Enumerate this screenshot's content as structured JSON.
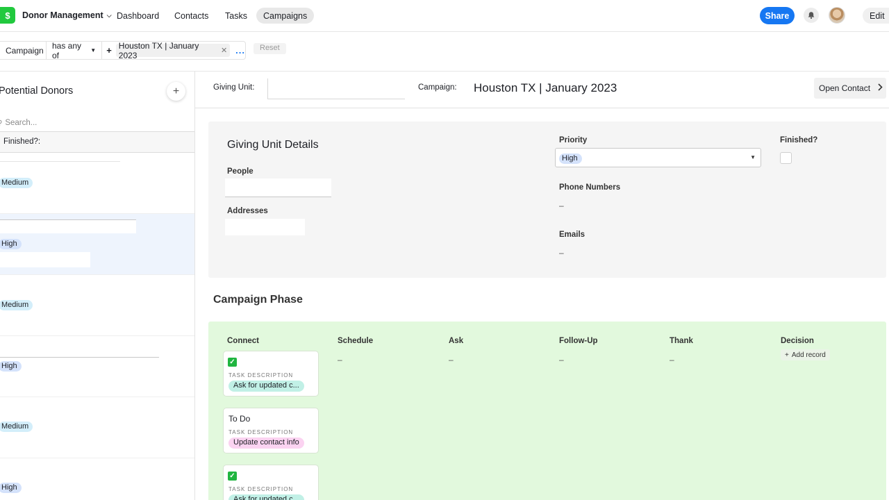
{
  "topnav": {
    "logo_glyph": "$",
    "app_title": "Donor Management",
    "tabs": [
      "Dashboard",
      "Contacts",
      "Tasks",
      "Campaigns"
    ],
    "active_tab": "Campaigns",
    "share_label": "Share",
    "edit_label": "Edit",
    "bell_icon": "bell-icon",
    "accent_color": "#1677f2",
    "logo_color": "#21c93e"
  },
  "filter": {
    "field": "Campaign",
    "operator": "has any of",
    "add_glyph": "+",
    "value": "Houston TX | January 2023",
    "more": "...",
    "reset_label": "Reset"
  },
  "sidebar": {
    "title": "Potential Donors",
    "add_glyph": "+",
    "search_placeholder": "Search...",
    "column_header": "Finished?:",
    "rows": [
      {
        "priority": "Medium"
      },
      {
        "priority": "High"
      },
      {
        "priority": "Medium"
      },
      {
        "priority": "High"
      },
      {
        "priority": "Medium"
      },
      {
        "priority": "High"
      }
    ]
  },
  "record": {
    "giving_unit_label": "Giving Unit:",
    "campaign_label": "Campaign:",
    "campaign_value": "Houston TX | January 2023",
    "open_contact_label": "Open Contact",
    "details": {
      "title": "Giving Unit Details",
      "people_label": "People",
      "addresses_label": "Addresses",
      "priority_label": "Priority",
      "priority_value": "High",
      "finished_label": "Finished?",
      "finished_checked": false,
      "phone_label": "Phone Numbers",
      "phone_value": "–",
      "emails_label": "Emails",
      "emails_value": "–"
    },
    "phase": {
      "title": "Campaign Phase",
      "columns": [
        "Connect",
        "Schedule",
        "Ask",
        "Follow-Up",
        "Thank",
        "Decision"
      ],
      "empty_value": "–",
      "add_record_label": "Add record",
      "task_label": "TASK DESCRIPTION",
      "tasks": [
        {
          "done": true,
          "title": "",
          "description": "Ask for updated c..."
        },
        {
          "done": false,
          "title": "To Do",
          "description": "Update contact info"
        },
        {
          "done": true,
          "title": "",
          "description": "Ask for updated c..."
        }
      ]
    }
  }
}
